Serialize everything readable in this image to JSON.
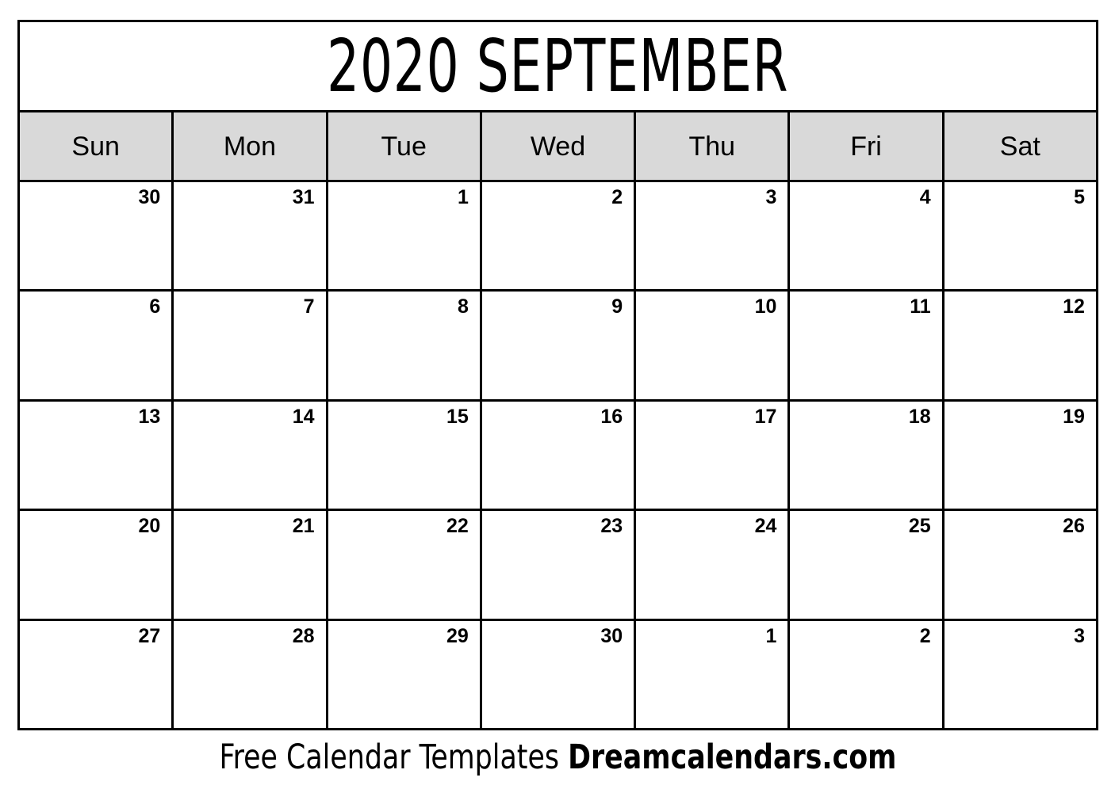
{
  "calendar": {
    "title": "2020 SEPTEMBER",
    "year": "2020",
    "month": "SEPTEMBER",
    "header_bg": "#d9d9d9",
    "border_color": "#000000",
    "background": "#ffffff",
    "weekday_headers": [
      {
        "label": "Sun"
      },
      {
        "label": "Mon"
      },
      {
        "label": "Tue"
      },
      {
        "label": "Wed"
      },
      {
        "label": "Thu"
      },
      {
        "label": "Fri"
      },
      {
        "label": "Sat"
      }
    ],
    "weeks": [
      {
        "days": [
          {
            "num": "30",
            "in_month": false
          },
          {
            "num": "31",
            "in_month": false
          },
          {
            "num": "1",
            "in_month": true
          },
          {
            "num": "2",
            "in_month": true
          },
          {
            "num": "3",
            "in_month": true
          },
          {
            "num": "4",
            "in_month": true
          },
          {
            "num": "5",
            "in_month": true
          }
        ]
      },
      {
        "days": [
          {
            "num": "6",
            "in_month": true
          },
          {
            "num": "7",
            "in_month": true
          },
          {
            "num": "8",
            "in_month": true
          },
          {
            "num": "9",
            "in_month": true
          },
          {
            "num": "10",
            "in_month": true
          },
          {
            "num": "11",
            "in_month": true
          },
          {
            "num": "12",
            "in_month": true
          }
        ]
      },
      {
        "days": [
          {
            "num": "13",
            "in_month": true
          },
          {
            "num": "14",
            "in_month": true
          },
          {
            "num": "15",
            "in_month": true
          },
          {
            "num": "16",
            "in_month": true
          },
          {
            "num": "17",
            "in_month": true
          },
          {
            "num": "18",
            "in_month": true
          },
          {
            "num": "19",
            "in_month": true
          }
        ]
      },
      {
        "days": [
          {
            "num": "20",
            "in_month": true
          },
          {
            "num": "21",
            "in_month": true
          },
          {
            "num": "22",
            "in_month": true
          },
          {
            "num": "23",
            "in_month": true
          },
          {
            "num": "24",
            "in_month": true
          },
          {
            "num": "25",
            "in_month": true
          },
          {
            "num": "26",
            "in_month": true
          }
        ]
      },
      {
        "days": [
          {
            "num": "27",
            "in_month": true
          },
          {
            "num": "28",
            "in_month": true
          },
          {
            "num": "29",
            "in_month": true
          },
          {
            "num": "30",
            "in_month": true
          },
          {
            "num": "1",
            "in_month": false
          },
          {
            "num": "2",
            "in_month": false
          },
          {
            "num": "3",
            "in_month": false
          }
        ]
      }
    ]
  },
  "footer": {
    "tagline": "Free Calendar Templates",
    "brand": "Dreamcalendars.com"
  }
}
